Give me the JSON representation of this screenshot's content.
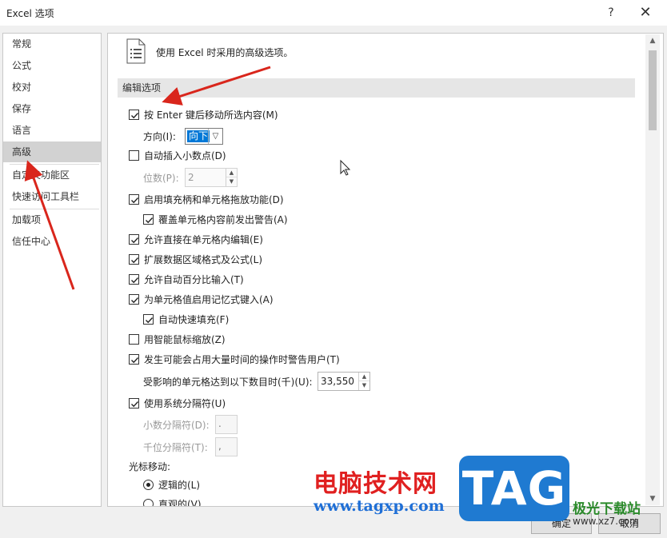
{
  "window": {
    "title": "Excel 选项",
    "help_label": "?",
    "close_label": "✕"
  },
  "sidebar": {
    "items": [
      {
        "label": "常规"
      },
      {
        "label": "公式"
      },
      {
        "label": "校对"
      },
      {
        "label": "保存"
      },
      {
        "label": "语言"
      },
      {
        "label": "高级",
        "selected": true
      },
      {
        "label": "自定义功能区"
      },
      {
        "label": "快速访问工具栏"
      },
      {
        "label": "加载项"
      },
      {
        "label": "信任中心"
      }
    ]
  },
  "main": {
    "header_icon": "document-list-icon",
    "header_text": "使用 Excel 时采用的高级选项。",
    "section_title": "编辑选项",
    "options": {
      "move_after_enter": {
        "label": "按 Enter 键后移动所选内容(M)",
        "checked": true
      },
      "direction_label": "方向(I):",
      "direction_value": "向下",
      "auto_decimal": {
        "label": "自动插入小数点(D)",
        "checked": false
      },
      "places_label": "位数(P):",
      "places_value": "2",
      "fill_handle": {
        "label": "启用填充柄和单元格拖放功能(D)",
        "checked": true
      },
      "alert_overwrite": {
        "label": "覆盖单元格内容前发出警告(A)",
        "checked": true
      },
      "edit_in_cell": {
        "label": "允许直接在单元格内编辑(E)",
        "checked": true
      },
      "extend_formats": {
        "label": "扩展数据区域格式及公式(L)",
        "checked": true
      },
      "auto_percent": {
        "label": "允许自动百分比输入(T)",
        "checked": true
      },
      "autocomplete": {
        "label": "为单元格值启用记忆式键入(A)",
        "checked": true
      },
      "flash_fill": {
        "label": "自动快速填充(F)",
        "checked": true
      },
      "zoom_intellimouse": {
        "label": "用智能鼠标缩放(Z)",
        "checked": false
      },
      "alert_long_op": {
        "label": "发生可能会占用大量时间的操作时警告用户(T)",
        "checked": true
      },
      "cells_affected_label": "受影响的单元格达到以下数目时(千)(U):",
      "cells_affected_value": "33,550",
      "system_separators": {
        "label": "使用系统分隔符(U)",
        "checked": true
      },
      "decimal_sep_label": "小数分隔符(D):",
      "decimal_sep_value": ".",
      "thousands_sep_label": "千位分隔符(T):",
      "thousands_sep_value": ",",
      "cursor_movement_label": "光标移动:",
      "cursor_logical": {
        "label": "逻辑的(L)",
        "selected": true
      },
      "cursor_visual": {
        "label": "直观的(V)",
        "selected": false
      }
    }
  },
  "footer": {
    "ok_label": "确定",
    "cancel_label": "取消"
  },
  "watermarks": {
    "site_cn": "电脑技术网",
    "site_url": "www.tagxp.com",
    "logo_text": "TAG",
    "site2_cn": "极光下载站",
    "site2_url": "www.xz7.com"
  },
  "colors": {
    "selection": "#0078d7",
    "annotation_arrow": "#d9261c",
    "logo_bg": "#1f7ad1"
  }
}
